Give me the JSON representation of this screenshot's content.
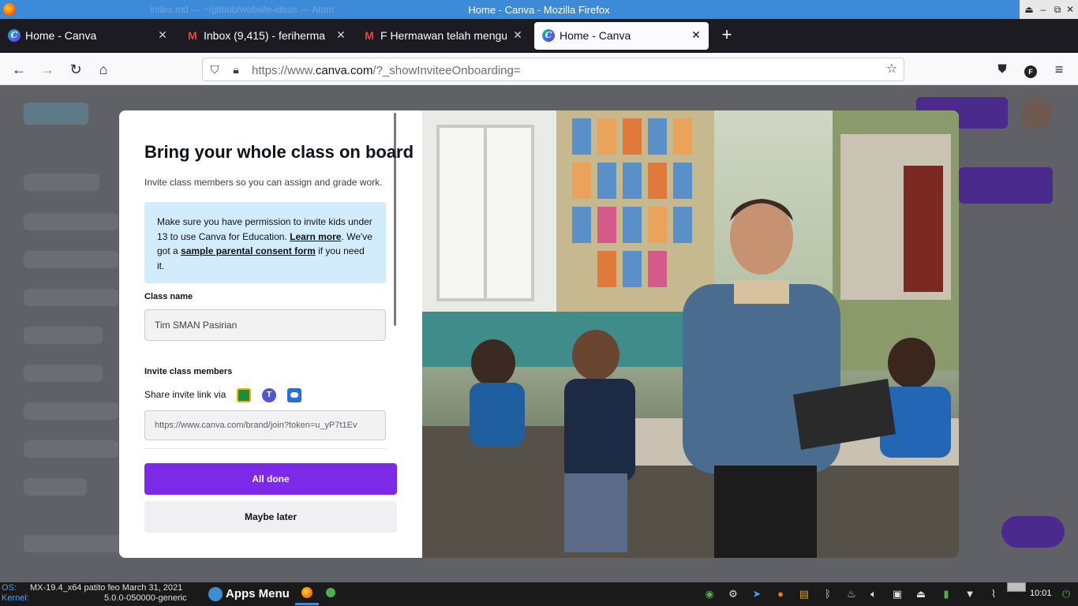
{
  "window": {
    "title": "Home - Canva - Mozilla Firefox",
    "faint_text": "index.md — ~/github/website-ideas — Atom"
  },
  "tabs": [
    {
      "label": "Home - Canva",
      "favicon": "canva-icon"
    },
    {
      "label": "Inbox (9,415) - feriherma",
      "favicon": "gmail-icon"
    },
    {
      "label": "F Hermawan telah mengu",
      "favicon": "gmail-icon"
    },
    {
      "label": "Home - Canva",
      "favicon": "canva-icon",
      "active": true
    }
  ],
  "nav": {
    "url_prefix": "https://www.",
    "url_domain": "canva.com",
    "url_suffix": "/?_showInviteeOnboarding="
  },
  "modal": {
    "heading": "Bring your whole class on board",
    "subtitle": "Invite class members so you can assign and grade work.",
    "notice": {
      "text_1": "Make sure you have permission to invite kids under 13 to use Canva for Education. ",
      "link_1": "Learn more",
      "text_2": ". We've got a ",
      "link_2": "sample parental consent form",
      "text_3": " if you need it."
    },
    "class_name_label": "Class name",
    "class_name_value": "Tim SMAN Pasirian",
    "invite_label": "Invite class members",
    "share_label": "Share invite link via",
    "share_targets": [
      "google-classroom-icon",
      "microsoft-teams-icon",
      "remind-icon"
    ],
    "invite_link": "https://www.canva.com/brand/join?token=u_yP7t1Ev",
    "primary_button": "All done",
    "secondary_button": "Maybe later"
  },
  "taskbar": {
    "os_label": "OS:",
    "os_value": "MX-19.4_x64 patito feo March 31, 2021",
    "kernel_label": "Kernel:",
    "kernel_value": "5.0.0-050000-generic",
    "apps_menu": "Apps Menu",
    "clock": "10:01"
  },
  "colors": {
    "accent": "#7d2ae8",
    "notice_bg": "#d3ecfb",
    "titlebar": "#3c8ad8"
  }
}
